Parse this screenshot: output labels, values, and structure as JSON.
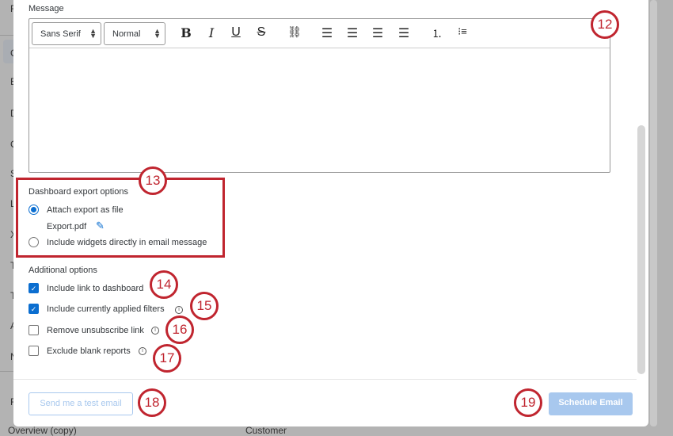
{
  "background": {
    "letters": [
      "F",
      "C",
      "E",
      "D",
      "C",
      "S",
      "L",
      "X",
      "T",
      "T",
      "A",
      "N",
      "F"
    ],
    "bottom_items": [
      "Overview (copy)",
      "Customer"
    ]
  },
  "message": {
    "label": "Message",
    "font_select": "Sans Serif",
    "size_select": "Normal",
    "toolbar": [
      "bold-icon",
      "italic-icon",
      "underline-icon",
      "strikethrough-icon",
      "link-icon",
      "align-left-icon",
      "align-center-icon",
      "align-right-icon",
      "align-justify-icon",
      "ordered-list-icon",
      "bullet-list-icon"
    ]
  },
  "export": {
    "title": "Dashboard export options",
    "attach_label": "Attach export as file",
    "filename": "Export.pdf",
    "include_label": "Include widgets directly in email message",
    "selected": "attach"
  },
  "additional": {
    "title": "Additional options",
    "options": [
      {
        "label": "Include link to dashboard",
        "checked": true
      },
      {
        "label": "Include currently applied filters",
        "checked": true
      },
      {
        "label": "Remove unsubscribe link",
        "checked": false
      },
      {
        "label": "Exclude blank reports",
        "checked": false
      }
    ]
  },
  "footer": {
    "test_button": "Send me a test email",
    "schedule_button": "Schedule Email"
  },
  "badges": [
    "12",
    "13",
    "14",
    "15",
    "16",
    "17",
    "18",
    "19"
  ],
  "colors": {
    "accent": "#0b6ed0",
    "annotation": "#c0252f",
    "disabled_button": "#a8c8ee"
  }
}
